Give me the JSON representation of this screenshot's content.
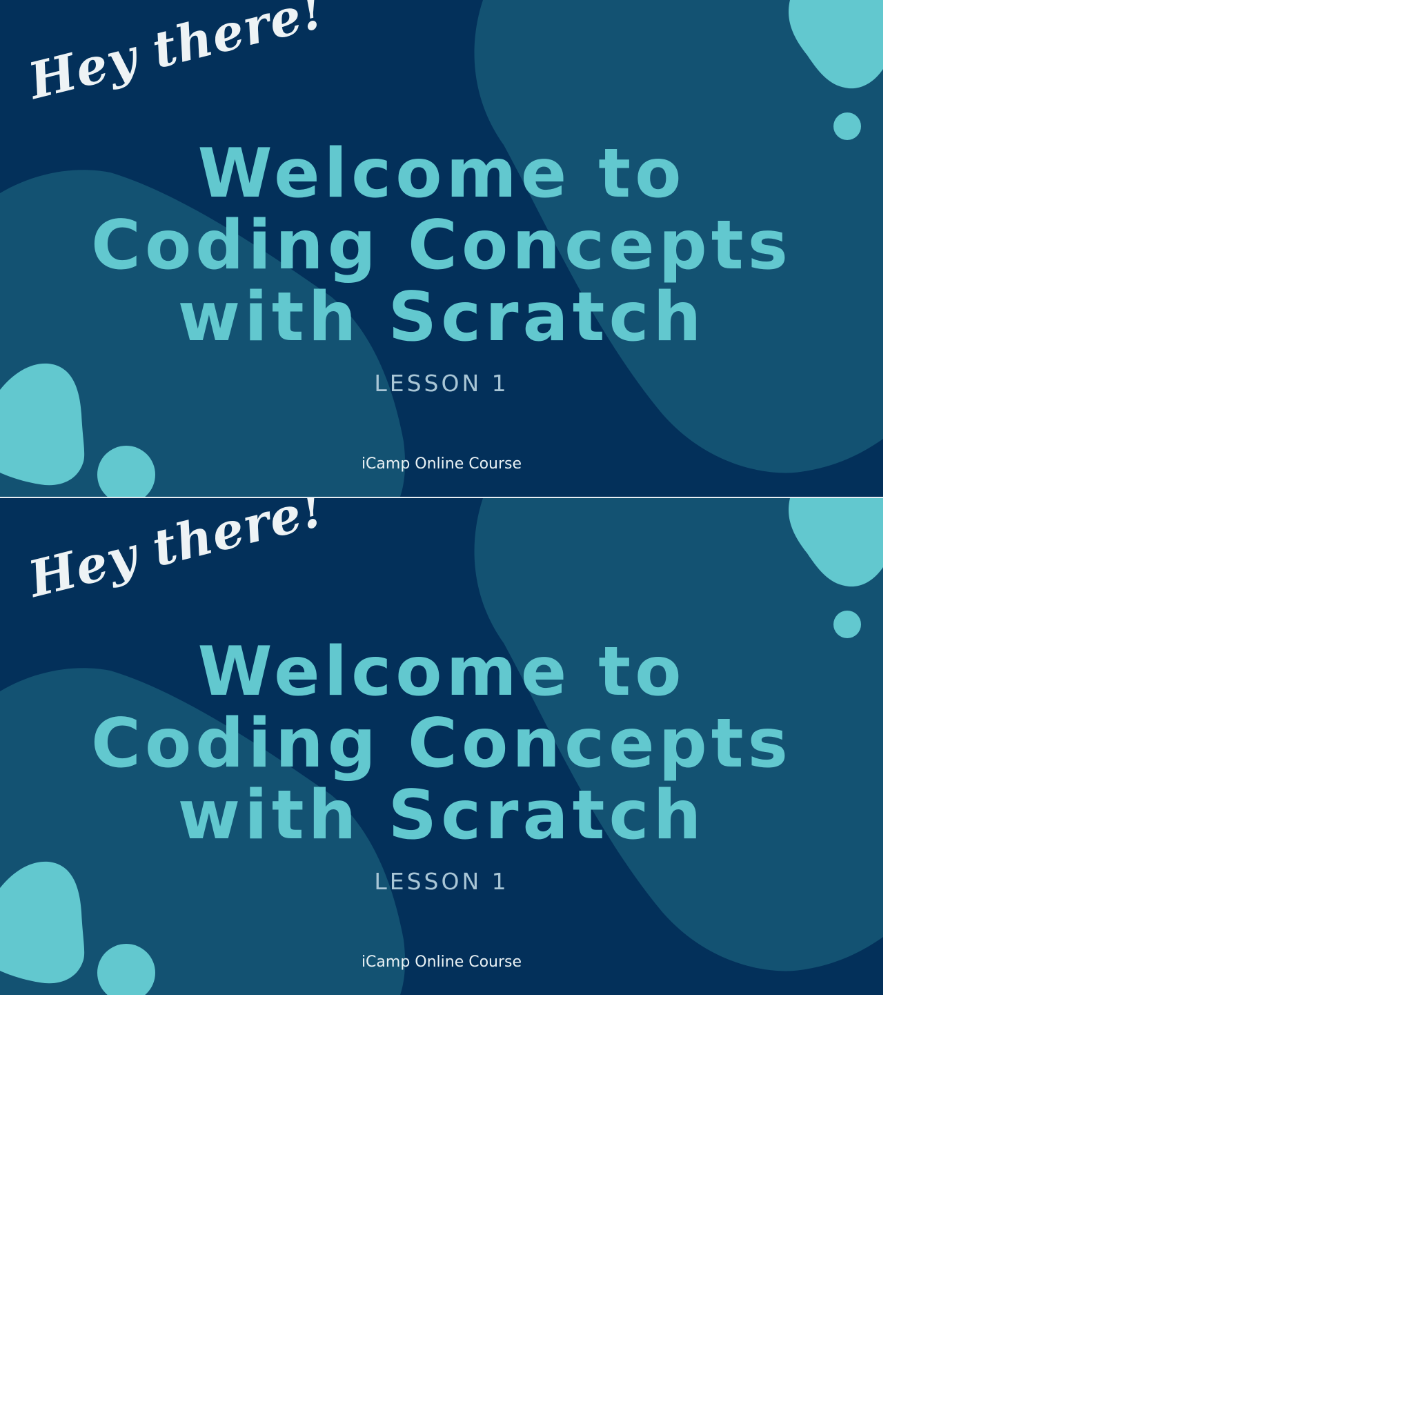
{
  "slides": [
    {
      "greeting": "Hey there!",
      "title_lines": [
        "Welcome to",
        "Coding Concepts",
        "with Scratch"
      ],
      "lesson": "LESSON 1",
      "footer": "iCamp Online Course"
    },
    {
      "greeting": "Hey there!",
      "title_lines": [
        "Welcome to",
        "Coding Concepts",
        "with Scratch"
      ],
      "lesson": "LESSON 1",
      "footer": "iCamp Online Course"
    }
  ],
  "colors": {
    "background": "#03305a",
    "blob_mid": "#135272",
    "accent": "#62c8cf",
    "greeting": "#eef3f5"
  }
}
